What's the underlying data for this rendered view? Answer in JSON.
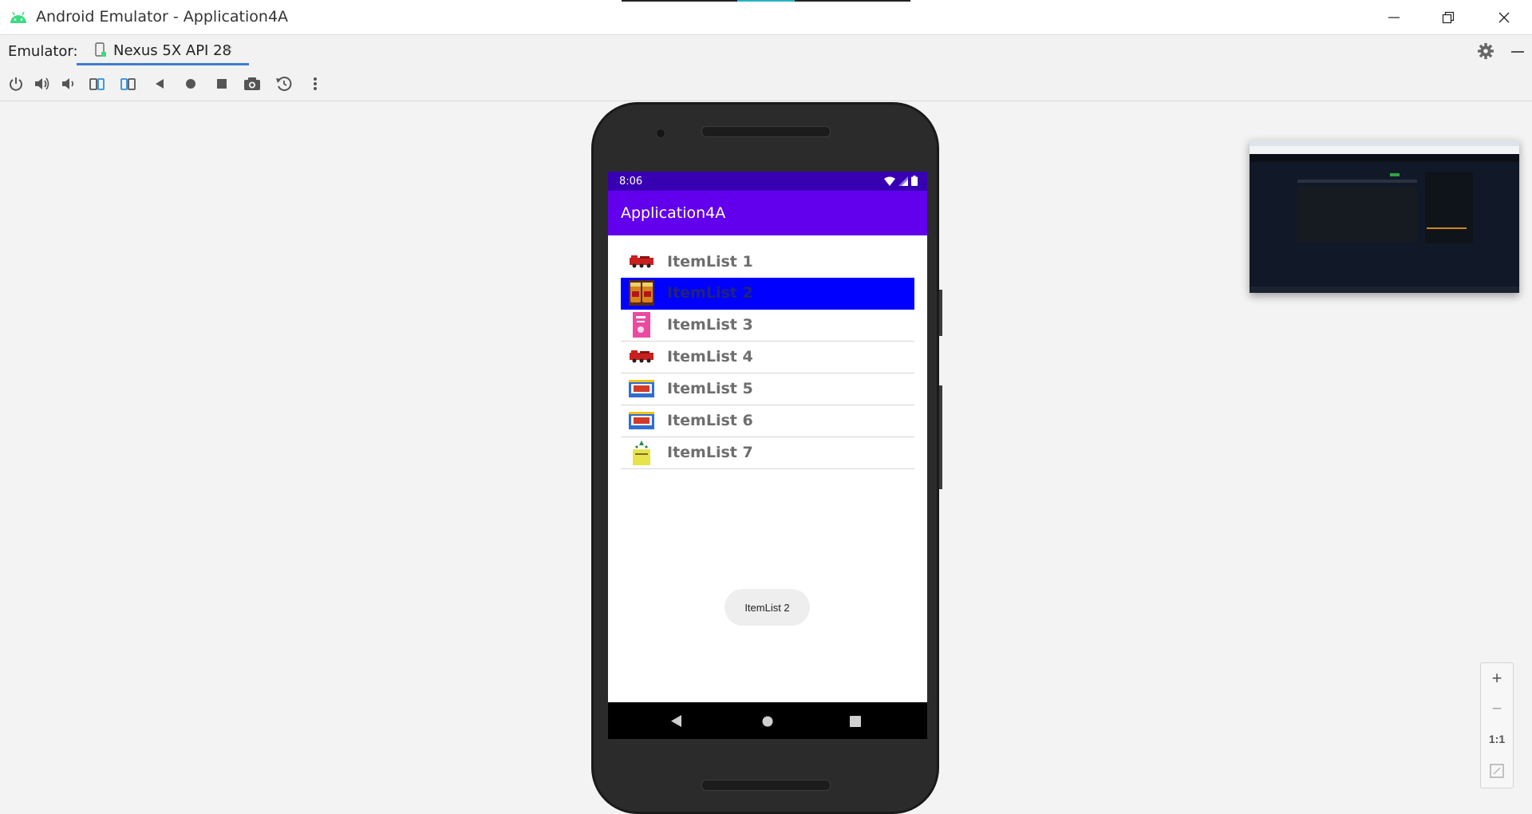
{
  "window": {
    "title": "Android Emulator - Application4A",
    "minimize_glyph": "—",
    "restore_glyph": "❐",
    "close_glyph": "✕"
  },
  "tabs": {
    "emulator_label": "Emulator:",
    "device_tab_label": "Nexus 5X API 28",
    "device_tab_close": "×"
  },
  "toolbar": {
    "items": [
      "power-icon",
      "volume-up-icon",
      "volume-down-icon",
      "rotate-left-icon",
      "rotate-right-icon",
      "back-icon",
      "home-icon",
      "overview-icon",
      "screenshot-icon",
      "snapshot-icon",
      "more-icon"
    ]
  },
  "device": {
    "status_time": "8:06",
    "app_title": "Application4A",
    "list_items": [
      {
        "label": "ItemList 1",
        "thumb": "red-truck-image",
        "selected": false
      },
      {
        "label": "ItemList 2",
        "thumb": "jars-image",
        "selected": true
      },
      {
        "label": "ItemList 3",
        "thumb": "pink-book-image",
        "selected": false
      },
      {
        "label": "ItemList 4",
        "thumb": "red-truck-image",
        "selected": false
      },
      {
        "label": "ItemList 5",
        "thumb": "blue-box-image",
        "selected": false
      },
      {
        "label": "ItemList 6",
        "thumb": "blue-box-image",
        "selected": false
      },
      {
        "label": "ItemList 7",
        "thumb": "yellow-card-image",
        "selected": false
      }
    ],
    "toast_text": "ItemList 2"
  },
  "zoom": {
    "zoom_in": "+",
    "zoom_out": "−",
    "one_to_one": "1:1"
  },
  "colors": {
    "status_bar": "#3700b3",
    "app_bar": "#6200ee",
    "selected_row": "#0000ff",
    "tab_underline": "#3d7cd6",
    "android_green": "#3ddc84"
  }
}
